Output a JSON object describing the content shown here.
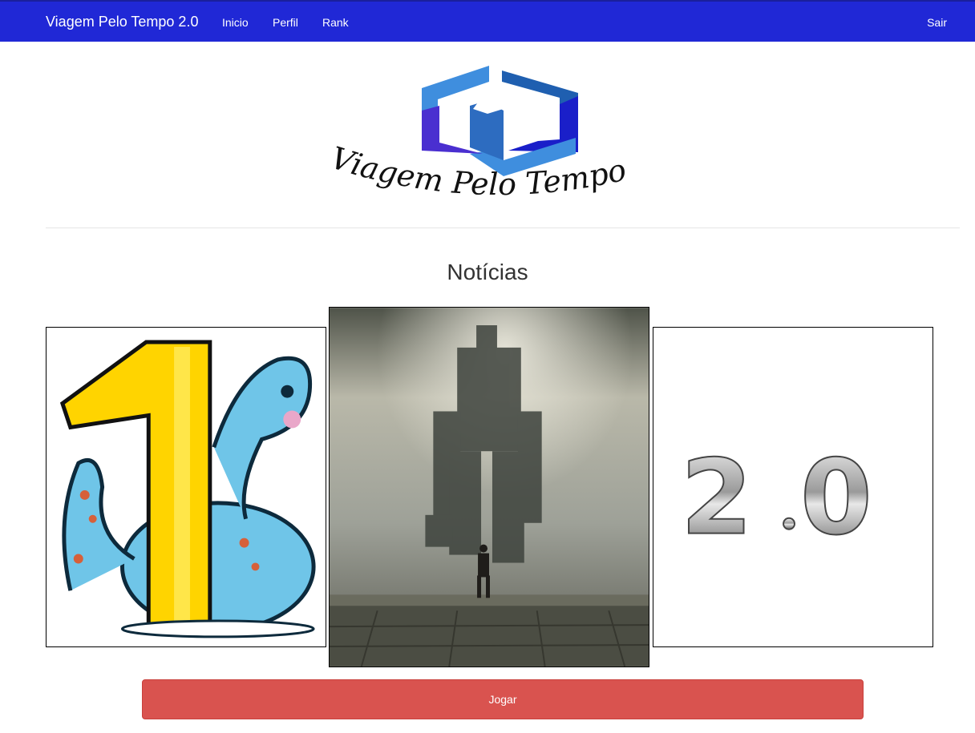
{
  "navbar": {
    "brand": "Viagem Pelo Tempo 2.0",
    "links": [
      "Inicio",
      "Perfil",
      "Rank"
    ],
    "logout": "Sair",
    "color": "#2028d6"
  },
  "logo": {
    "text": "Viagem Pelo Tempo",
    "colors": [
      "#1f5fb0",
      "#3f8ede",
      "#4a2fd0",
      "#1a1fc9"
    ]
  },
  "news": {
    "title": "Notícias",
    "items": [
      {
        "image": "dinosaur-number-one-illustration"
      },
      {
        "image": "giant-colossus-in-fog-game-scene"
      },
      {
        "image": "chrome-2-0-emblem"
      }
    ]
  },
  "actions": {
    "play_label": "Jogar",
    "play_color": "#d9534f"
  }
}
